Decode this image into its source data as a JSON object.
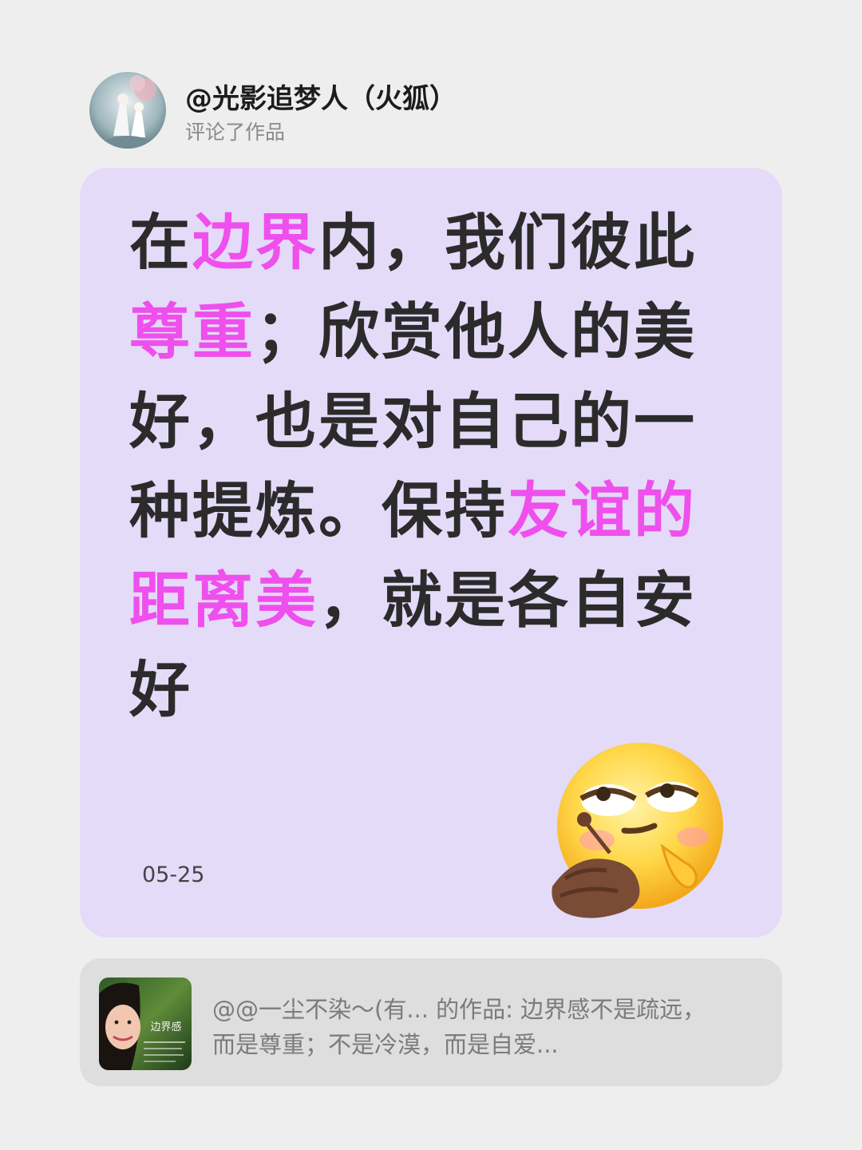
{
  "header": {
    "username": "@光影追梦人（火狐）",
    "action": "评论了作品"
  },
  "comment": {
    "segments": [
      {
        "text": "在",
        "highlight": false
      },
      {
        "text": "边界",
        "highlight": true
      },
      {
        "text": "内，我们彼此",
        "highlight": false
      },
      {
        "text": "尊重",
        "highlight": true
      },
      {
        "text": "；欣赏他人的美好，也是对自己的一种提炼。保持",
        "highlight": false
      },
      {
        "text": "友谊的距离美",
        "highlight": true
      },
      {
        "text": "，就是各自安好",
        "highlight": false
      }
    ],
    "date": "05-25",
    "highlight_color": "#ef4fec",
    "emoji_icon": "smirk-face-emoji"
  },
  "reference": {
    "text": "@@一尘不染～(有... 的作品: 边界感不是疏远，\n而是尊重；不是冷漠，而是自爱...",
    "thumbnail_title": "边界感"
  }
}
